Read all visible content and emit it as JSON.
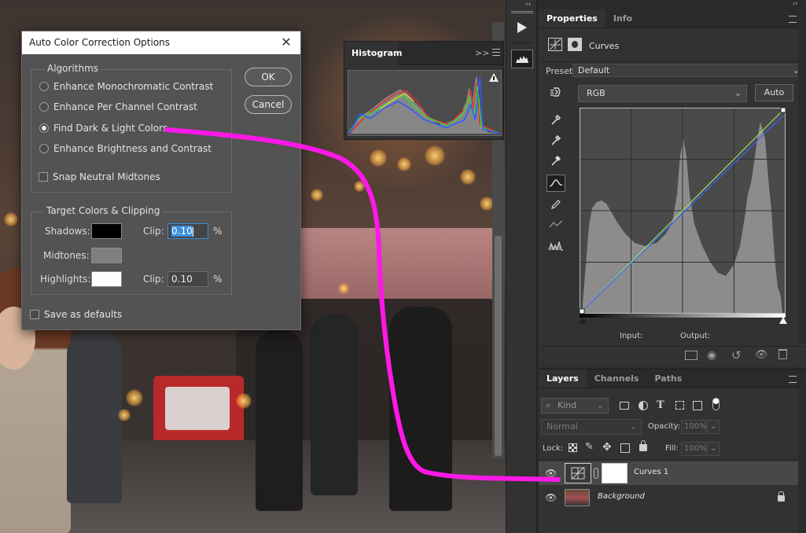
{
  "colors": {
    "accent_blue": "#3a8fe0",
    "annotation_magenta": "#ff18e8"
  },
  "dialog": {
    "title": "Auto Color Correction Options",
    "algorithms_label": "Algorithms",
    "options": [
      {
        "label": "Enhance Monochromatic Contrast",
        "selected": false
      },
      {
        "label": "Enhance Per Channel Contrast",
        "selected": false
      },
      {
        "label": "Find Dark & Light Colors",
        "selected": true
      },
      {
        "label": "Enhance Brightness and Contrast",
        "selected": false
      }
    ],
    "snap_label": "Snap Neutral Midtones",
    "target_label": "Target Colors & Clipping",
    "shadows_label": "Shadows:",
    "midtones_label": "Midtones:",
    "highlights_label": "Highlights:",
    "clip_label": "Clip:",
    "shadows_clip": "0.10",
    "highlights_clip": "0.10",
    "percent": "%",
    "save_defaults_label": "Save as defaults",
    "ok_label": "OK",
    "cancel_label": "Cancel",
    "swatch_colors": {
      "shadows": "#000000",
      "midtones": "#808080",
      "highlights": "#ffffff"
    }
  },
  "histogram": {
    "title": "Histogram",
    "menu_glyph": ">>"
  },
  "properties": {
    "tabs": [
      "Properties",
      "Info"
    ],
    "adjustment_name": "Curves",
    "preset_label": "Preset:",
    "preset_value": "Default",
    "channel_value": "RGB",
    "auto_label": "Auto",
    "input_label": "Input:",
    "output_label": "Output:"
  },
  "layers": {
    "tabs": [
      "Layers",
      "Channels",
      "Paths"
    ],
    "kind_placeholder": "Kind",
    "blend_mode": "Normal",
    "opacity_label": "Opacity:",
    "opacity_value": "100%",
    "lock_label": "Lock:",
    "fill_label": "Fill:",
    "fill_value": "100%",
    "items": [
      {
        "name": "Curves 1"
      },
      {
        "name": "Background"
      }
    ]
  }
}
